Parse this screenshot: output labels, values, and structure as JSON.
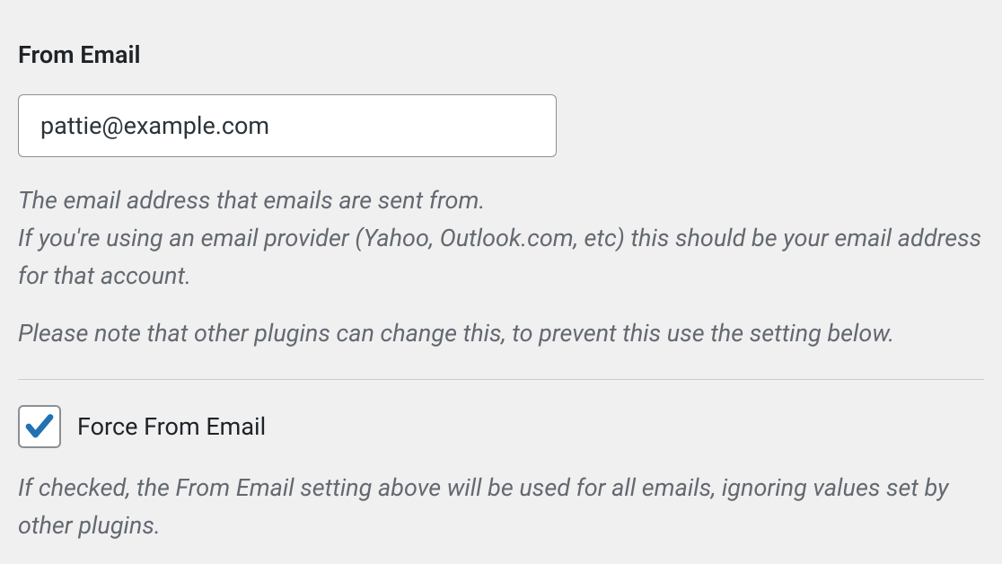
{
  "from_email": {
    "label": "From Email",
    "value": "pattie@example.com",
    "description_line1": "The email address that emails are sent from.",
    "description_line2": "If you're using an email provider (Yahoo, Outlook.com, etc) this should be your email address for that account.",
    "description_note": "Please note that other plugins can change this, to prevent this use the setting below."
  },
  "force_from_email": {
    "checked": true,
    "label": "Force From Email",
    "description": "If checked, the From Email setting above will be used for all emails, ignoring values set by other plugins."
  },
  "colors": {
    "checkmark": "#2271b1"
  }
}
